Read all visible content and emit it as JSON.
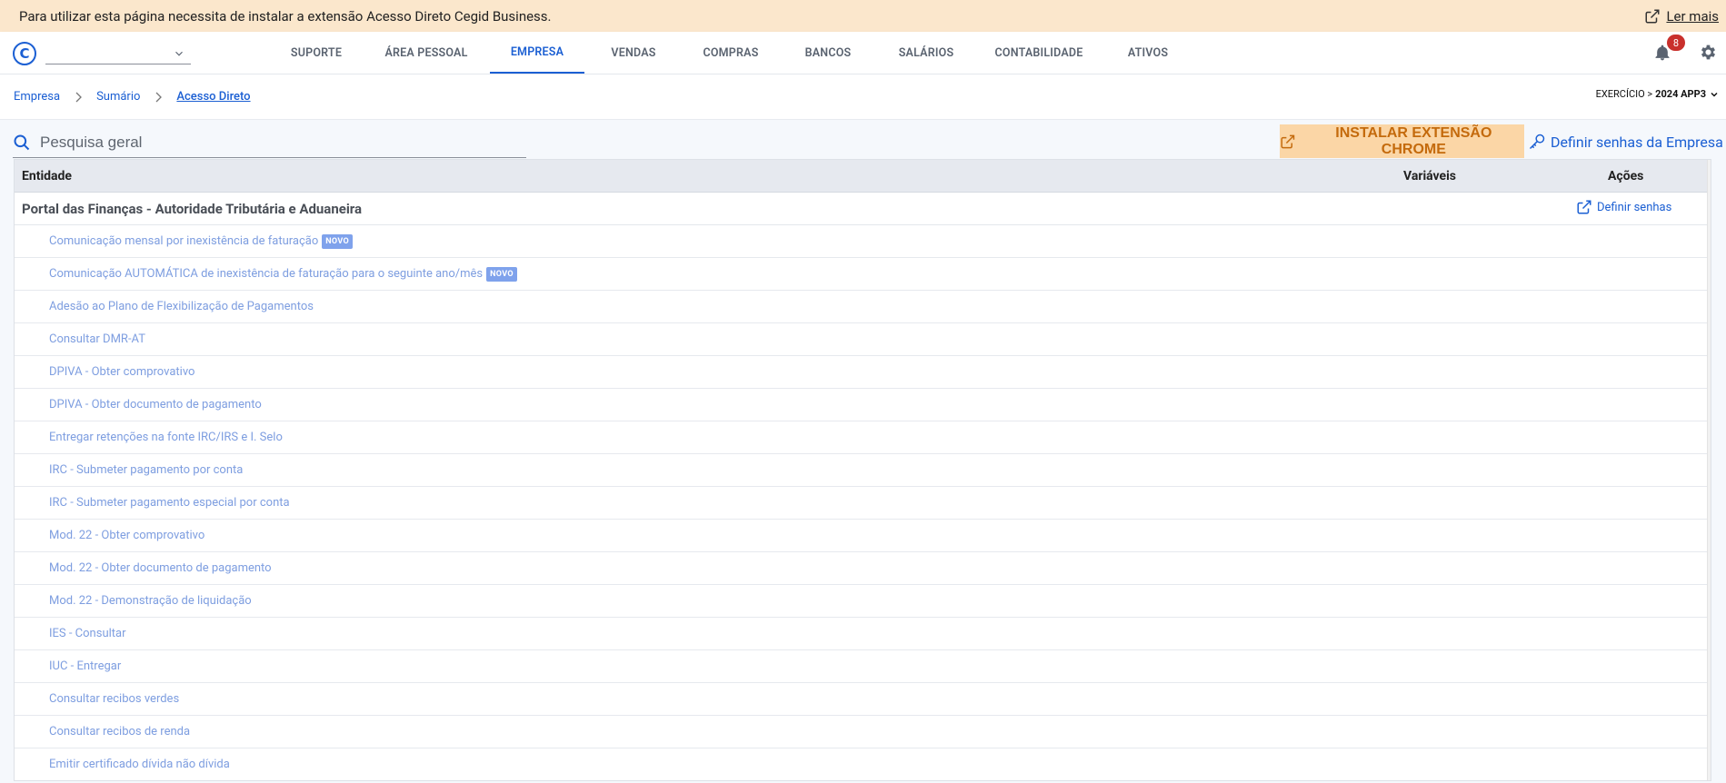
{
  "banner": {
    "message": "Para utilizar esta página necessita de instalar a extensão Acesso Direto Cegid Business.",
    "link_label": "Ler mais"
  },
  "header": {
    "logo_letter": "C",
    "company_select_value": "",
    "nav": [
      {
        "label": "SUPORTE",
        "active": false
      },
      {
        "label": "ÁREA PESSOAL",
        "active": false
      },
      {
        "label": "EMPRESA",
        "active": true
      },
      {
        "label": "VENDAS",
        "active": false
      },
      {
        "label": "COMPRAS",
        "active": false
      },
      {
        "label": "BANCOS",
        "active": false
      },
      {
        "label": "SALÁRIOS",
        "active": false
      },
      {
        "label": "CONTABILIDADE",
        "active": false
      },
      {
        "label": "ATIVOS",
        "active": false
      }
    ],
    "notifications_count": "8"
  },
  "breadcrumb": {
    "items": [
      "Empresa",
      "Sumário",
      "Acesso Direto"
    ]
  },
  "exercicio": {
    "prefix": "EXERCÍCIO >",
    "value": "2024 APP3"
  },
  "toolbar": {
    "search_placeholder": "Pesquisa geral",
    "install_button": "INSTALAR EXTENSÃO CHROME",
    "define_passwords_button": "Definir senhas da Empresa"
  },
  "table": {
    "headers": {
      "entity": "Entidade",
      "variables": "Variáveis",
      "actions": "Ações"
    },
    "group": {
      "title": "Portal das Finanças - Autoridade Tributária e Aduaneira",
      "action_label": "Definir senhas"
    },
    "rows": [
      {
        "label": "Comunicação mensal por inexistência de faturação",
        "badge": "NOVO"
      },
      {
        "label": "Comunicação AUTOMÁTICA de inexistência de faturação para o seguinte ano/mês",
        "badge": "NOVO"
      },
      {
        "label": "Adesão ao Plano de Flexibilização de Pagamentos",
        "badge": ""
      },
      {
        "label": "Consultar DMR-AT",
        "badge": ""
      },
      {
        "label": "DPIVA - Obter comprovativo",
        "badge": ""
      },
      {
        "label": "DPIVA - Obter documento de pagamento",
        "badge": ""
      },
      {
        "label": "Entregar retenções na fonte IRC/IRS e I. Selo",
        "badge": ""
      },
      {
        "label": "IRC - Submeter pagamento por conta",
        "badge": ""
      },
      {
        "label": "IRC - Submeter pagamento especial por conta",
        "badge": ""
      },
      {
        "label": "Mod. 22 - Obter comprovativo",
        "badge": ""
      },
      {
        "label": "Mod. 22 - Obter documento de pagamento",
        "badge": ""
      },
      {
        "label": "Mod. 22 - Demonstração de liquidação",
        "badge": ""
      },
      {
        "label": "IES - Consultar",
        "badge": ""
      },
      {
        "label": "IUC - Entregar",
        "badge": ""
      },
      {
        "label": "Consultar recibos verdes",
        "badge": ""
      },
      {
        "label": "Consultar recibos de renda",
        "badge": ""
      },
      {
        "label": "Emitir certificado dívida não dívida",
        "badge": ""
      }
    ]
  },
  "colors": {
    "accent": "#1b5fd3",
    "banner_bg": "#fbe7cc",
    "install_bg": "#fbd6a6",
    "install_text": "#c46a0c",
    "row_link": "#7e9ee0",
    "badge_bg": "#c9302c"
  },
  "icons": {
    "banner_link": "external-link-icon",
    "install": "external-link-icon",
    "define_passwords": "key-icon",
    "search": "search-icon",
    "notifications": "bell-icon",
    "settings": "gear-icon",
    "select": "chevron-down-icon",
    "breadcrumb_separator": "chevron-right-icon"
  }
}
